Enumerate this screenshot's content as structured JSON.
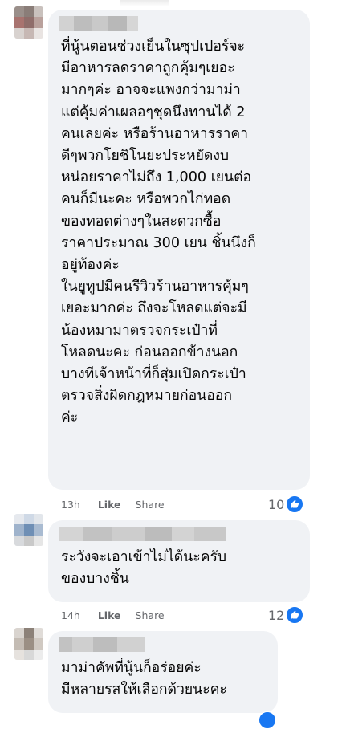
{
  "comments": [
    {
      "text_lines": [
        "ที่นู้นตอนช่วงเย็นในซุปเปอร์จะ",
        "มีอาหารลดราคาถูกคุ้มๆเยอะ",
        "มากๆค่ะ อาจจะแพงกว่ามาม่า",
        "แต่คุ้มค่าเผลอๆชุดนึงทานได้ 2",
        "คนเลยค่ะ หรือร้านอาหารราคา",
        "ดีๆพวกโยชิโนยะประหยัดงบ",
        "หน่อยราคาไม่ถึง 1,000 เยนต่อ",
        "คนก็มีนะคะ หรือพวกไก่ทอด",
        "ของทอดต่างๆในสะดวกซื้อ",
        "ราคาประมาณ 300 เยน ชิ้นนึงก็",
        "อยู่ท้องค่ะ",
        "ในยูทูปมีคนรีวิวร้านอาหารคุ้มๆ",
        "เยอะมากค่ะ ถึงจะโหลดแต่จะมี",
        "น้องหมามาตรวจกระเป๋าที่",
        "โหลดนะคะ ก่อนออกข้างนอก",
        "บางทีเจ้าหน้าที่ก็สุ่มเปิดกระเป๋า",
        "ตรวจสิ่งผิดกฎหมายก่อนออก",
        "ค่ะ"
      ],
      "time": "13h",
      "like_label": "Like",
      "share_label": "Share",
      "reactions": "10"
    },
    {
      "text_lines": [
        "ระวังจะเอาเข้าไม่ได้นะครับ",
        "ของบางชิ้น"
      ],
      "time": "14h",
      "like_label": "Like",
      "share_label": "Share",
      "reactions": "12"
    },
    {
      "text_lines": [
        "มาม่าคัพที่นู้นก็อร่อยค่ะ",
        "มีหลายรสให้เลือกด้วยนะคะ"
      ]
    }
  ],
  "colors": {
    "bubble_bg": "#f0f2f5",
    "meta_text": "#65676b",
    "like_blue": "#1877f2"
  }
}
